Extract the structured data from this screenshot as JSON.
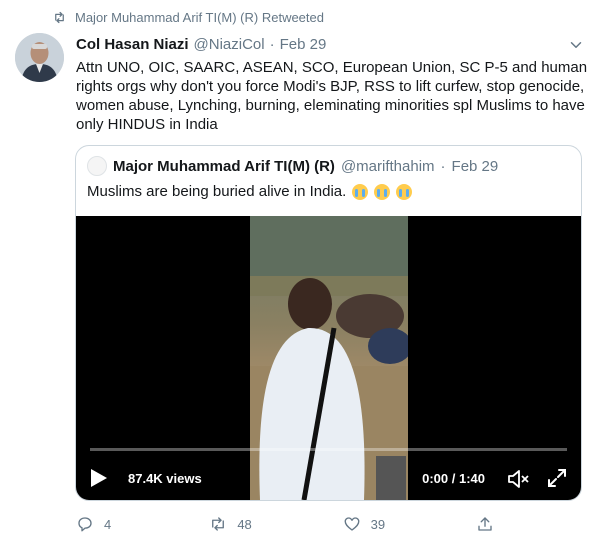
{
  "retweet_context": {
    "icon": "retweet-icon",
    "text": "Major Muhammad Arif TI(M) (R) Retweeted"
  },
  "tweet": {
    "author_name": "Col Hasan Niazi",
    "handle": "@NiaziCol",
    "separator": "·",
    "date": "Feb 29",
    "text": "Attn UNO, OIC, SAARC, ASEAN, SCO, European Union, SC P-5 and human rights orgs why don't you force Modi's BJP, RSS to lift curfew, stop genocide, women abuse, Lynching, burning, eleminating minorities spl Muslims to have only HINDUS in India"
  },
  "quoted_tweet": {
    "author_name": "Major Muhammad Arif TI(M) (R)",
    "handle": "@marifthahim",
    "separator": "·",
    "date": "Feb 29",
    "text": "Muslims are being buried alive in India.",
    "emoji": [
      "crying-face-icon",
      "crying-face-icon",
      "crying-face-icon"
    ]
  },
  "video": {
    "views": "87.4K views",
    "time": "0:00 / 1:40",
    "progress_fraction": 0
  },
  "actions": {
    "reply_count": "4",
    "retweet_count": "48",
    "like_count": "39"
  },
  "colors": {
    "secondary_text": "#657786",
    "border": "#ccd6dd",
    "primary_text": "#14171a"
  }
}
